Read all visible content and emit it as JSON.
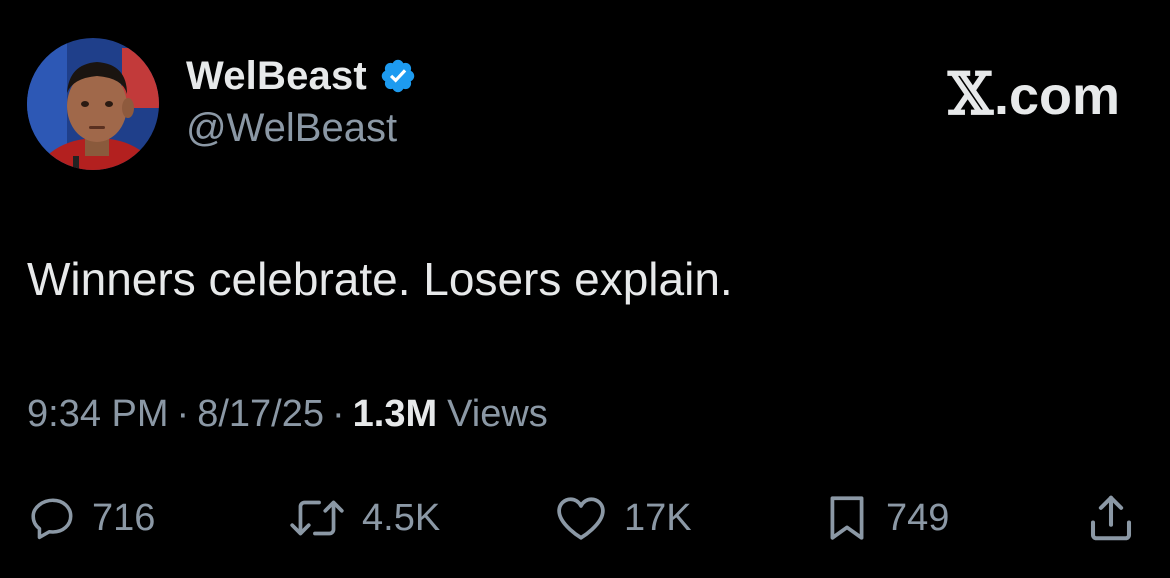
{
  "author": {
    "display_name": "WelBeast",
    "handle": "@WelBeast",
    "verified": true,
    "avatar_icon": "profile-photo"
  },
  "brand": {
    "x_glyph": "𝕏",
    "domain_suffix": ".com"
  },
  "tweet": {
    "text": "Winners celebrate. Losers explain."
  },
  "meta": {
    "time": "9:34 PM",
    "separator": "·",
    "date": "8/17/25",
    "views_count": "1.3M",
    "views_label": "Views"
  },
  "actions": {
    "replies": "716",
    "reposts": "4.5K",
    "likes": "17K",
    "bookmarks": "749"
  },
  "colors": {
    "background": "#000000",
    "primary_text": "#e7e9ea",
    "secondary_text": "#8b98a5",
    "verified_badge": "#1d9bf0"
  }
}
